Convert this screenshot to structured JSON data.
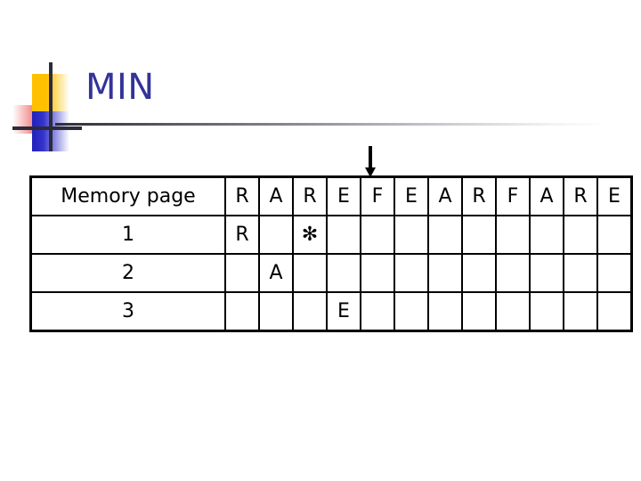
{
  "slide": {
    "title": "MIN",
    "title_color": "#333399"
  },
  "logo": {
    "yellow_color": "#FFC000",
    "blue_color": "#3333CC",
    "red_color": "#E03030",
    "line_color": "#2b2b3b"
  },
  "pointer": {
    "name": "down-arrow",
    "color": "#000000",
    "points_at_column_index": 5
  },
  "table": {
    "header": {
      "label": "Memory page",
      "reference_string": [
        "R",
        "A",
        "R",
        "E",
        "F",
        "E",
        "A",
        "R",
        "F",
        "A",
        "R",
        "E"
      ]
    },
    "page_value_color": "#CC66CC",
    "fault_mark_color": "#A82222",
    "fault_mark_glyph": "✻",
    "rows": [
      {
        "label": "1",
        "cells": [
          "R",
          "",
          "✻",
          "",
          "",
          "",
          "",
          "",
          "",
          "",
          "",
          ""
        ],
        "kinds": [
          "page",
          "",
          "fault",
          "",
          "",
          "",
          "",
          "",
          "",
          "",
          "",
          ""
        ]
      },
      {
        "label": "2",
        "cells": [
          "",
          "A",
          "",
          "",
          "",
          "",
          "",
          "",
          "",
          "",
          "",
          ""
        ],
        "kinds": [
          "",
          "page",
          "",
          "",
          "",
          "",
          "",
          "",
          "",
          "",
          "",
          ""
        ]
      },
      {
        "label": "3",
        "cells": [
          "",
          "",
          "",
          "E",
          "",
          "",
          "",
          "",
          "",
          "",
          "",
          ""
        ],
        "kinds": [
          "",
          "",
          "",
          "page",
          "",
          "",
          "",
          "",
          "",
          "",
          "",
          ""
        ]
      }
    ]
  }
}
